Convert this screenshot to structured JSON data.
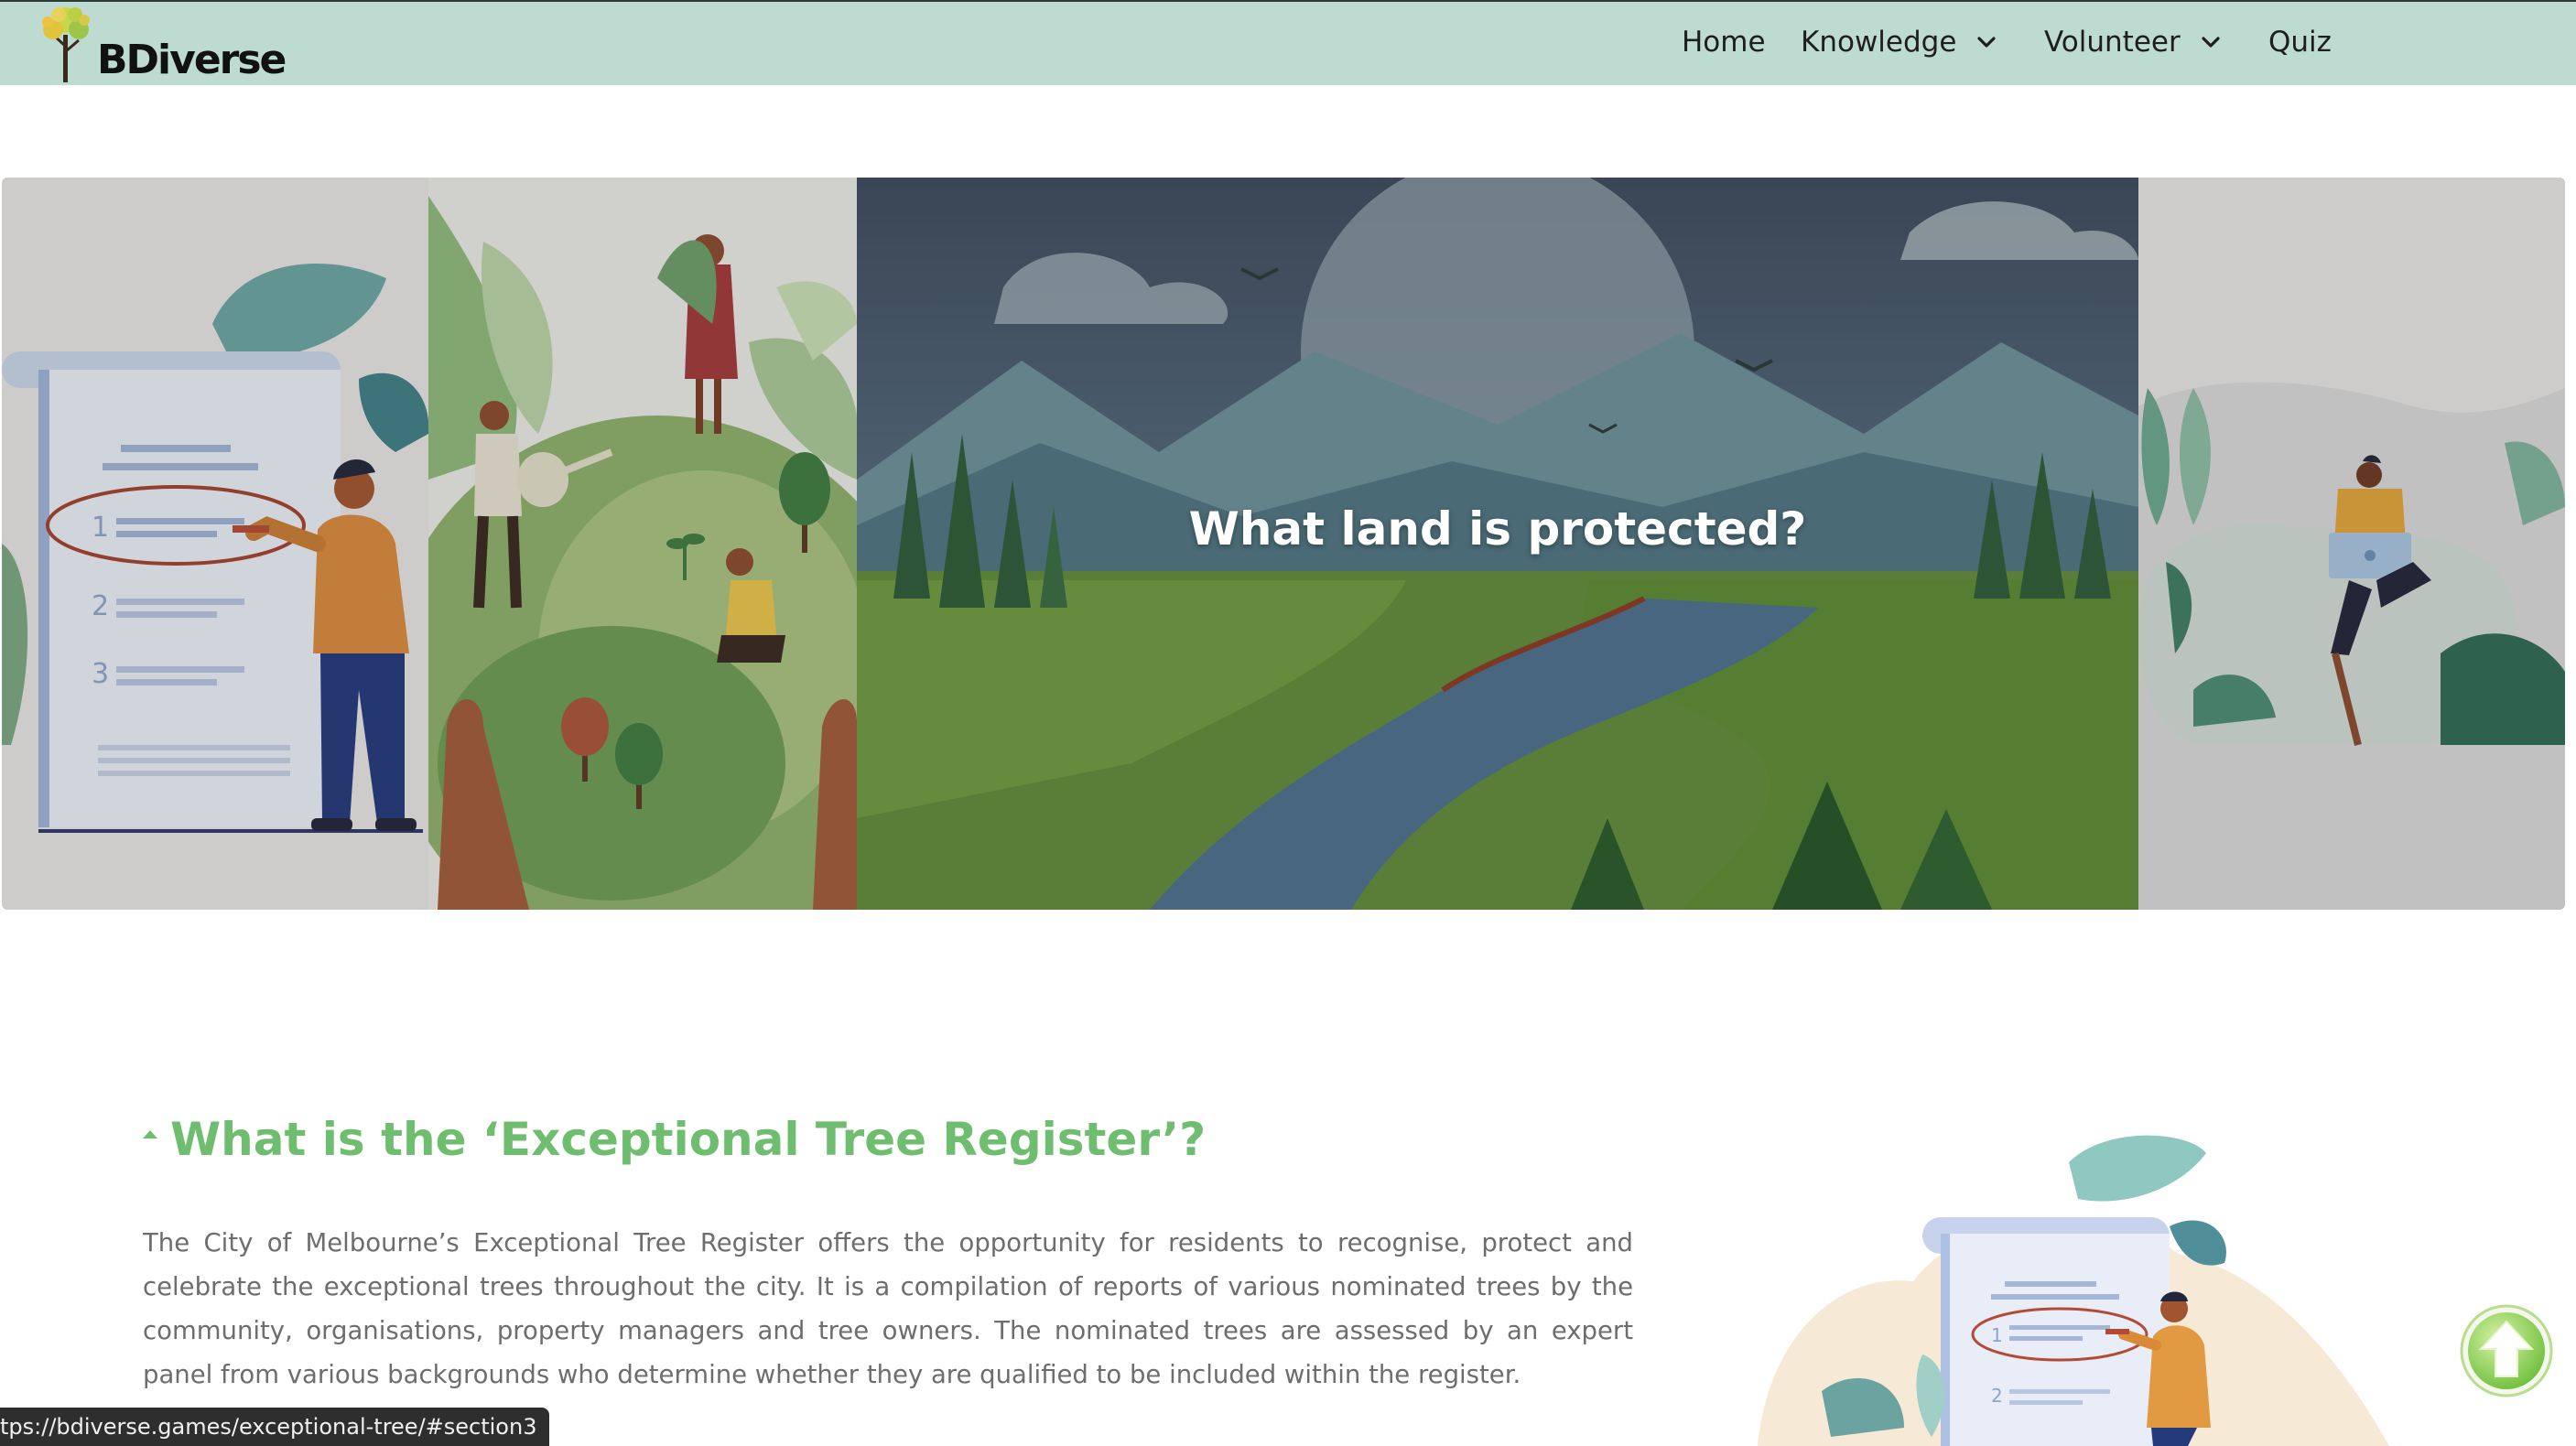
{
  "header": {
    "logo_text": "BDiverse",
    "nav": [
      {
        "label": "Home",
        "has_dropdown": false
      },
      {
        "label": "Knowledge",
        "has_dropdown": true
      },
      {
        "label": "Volunteer",
        "has_dropdown": true
      },
      {
        "label": "Quiz",
        "has_dropdown": false
      }
    ]
  },
  "hero": {
    "title": "What land is protected?"
  },
  "section": {
    "heading": "What is the ‘Exceptional Tree Register’?",
    "body": "The City of Melbourne’s Exceptional Tree Register offers the opportunity for residents to recognise, protect and celebrate the exceptional trees throughout the city. It is a compilation of reports of various nominated trees by the community, organisations, property managers and tree owners. The nominated trees are assessed by an expert panel from various backgrounds who determine whether they are qualified to be included within the register."
  },
  "status_bar": {
    "url": "tps://bdiverse.games/exceptional-tree/#section3"
  },
  "colors": {
    "header_bg": "#bedbd2",
    "accent_green": "#6fbd6e",
    "body_text": "#6d6d6d"
  },
  "icons": {
    "logo": "tree-logo-icon",
    "dropdown": "chevron-down-icon",
    "collapse": "caret-up-icon",
    "back_to_top": "arrow-up-icon"
  }
}
